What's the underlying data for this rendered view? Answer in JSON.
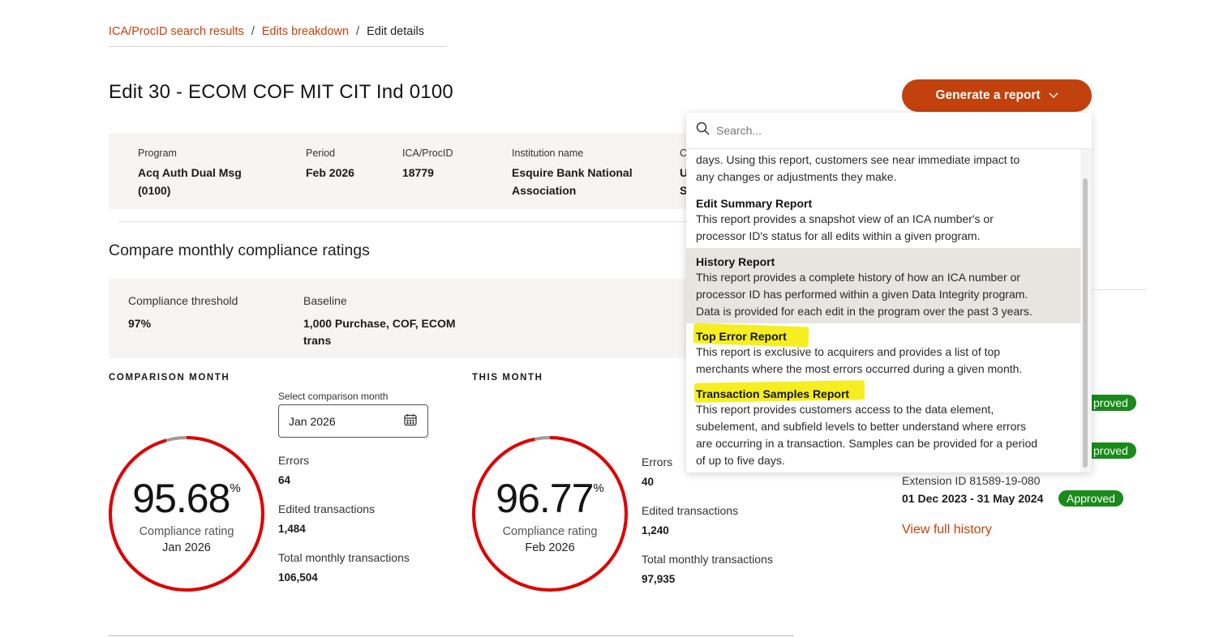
{
  "breadcrumb": {
    "items": [
      "ICA/ProcID search results",
      "Edits breakdown"
    ],
    "separator": "/",
    "current": "Edit details"
  },
  "page_title": "Edit 30 - ECOM COF MIT CIT Ind 0100",
  "generate_button": {
    "label": "Generate a report",
    "icon": "chevron-down-icon"
  },
  "info": {
    "program": {
      "label": "Program",
      "value_line1": "Acq Auth Dual Msg",
      "value_line2": "(0100)"
    },
    "period": {
      "label": "Period",
      "value": "Feb 2026"
    },
    "ica": {
      "label": "ICA/ProcID",
      "value": "18779"
    },
    "institution": {
      "label": "Institution name",
      "value_line1": "Esquire Bank National",
      "value_line2": "Association"
    },
    "partial": {
      "label": "C",
      "value_line1": "U",
      "value_line2": "S"
    }
  },
  "compare_section": {
    "title": "Compare monthly compliance ratings",
    "threshold_label": "Compliance threshold",
    "threshold_value": "97%",
    "baseline_label": "Baseline",
    "baseline_value_line1": "1,000 Purchase, COF, ECOM",
    "baseline_value_line2": "trans"
  },
  "comparison_month": {
    "heading": "COMPARISON MONTH",
    "select_label": "Select comparison month",
    "select_value": "Jan 2026",
    "rating": "95.68",
    "rating_unit": "%",
    "rating_fraction": 0.9568,
    "rating_caption": "Compliance rating",
    "rating_month": "Jan 2026",
    "errors_label": "Errors",
    "errors_value": "64",
    "edited_label": "Edited transactions",
    "edited_value": "1,484",
    "total_label": "Total monthly transactions",
    "total_value": "106,504"
  },
  "this_month": {
    "heading": "THIS MONTH",
    "rating": "96.77",
    "rating_unit": "%",
    "rating_fraction": 0.9677,
    "rating_caption": "Compliance rating",
    "rating_month": "Feb 2026",
    "errors_label": "Errors",
    "errors_value": "40",
    "edited_label": "Edited transactions",
    "edited_value": "1,240",
    "total_label": "Total monthly transactions",
    "total_value": "97,935"
  },
  "extension": {
    "badge_partial_1": "proved",
    "badge_partial_2": "proved",
    "id_text": "Extension ID 81589-19-080",
    "date_range": "01 Dec 2023 - 31 May 2024",
    "status": "Approved",
    "view_history": "View full history"
  },
  "dropdown": {
    "search_placeholder": "Search...",
    "search_icon": "search-icon",
    "partial_desc_line1": "days. Using this report, customers see near immediate impact to",
    "partial_desc_line2": "any changes or adjustments they make.",
    "items": [
      {
        "title": "Edit Summary Report",
        "desc_line1": "This report provides a snapshot view of an ICA number's or",
        "desc_line2": "processor ID's status for all edits within a given program."
      },
      {
        "title": "History Report",
        "desc_line1": "This report provides a complete history of how an ICA number or",
        "desc_line2": "processor ID has performed within a given Data Integrity program.",
        "desc_line3": "Data is provided for each edit in the program over the past 3 years."
      },
      {
        "title": "Top Error Report",
        "desc_line1": "This report is exclusive to acquirers and provides a list of top",
        "desc_line2": "merchants where the most errors occurred during a given month."
      },
      {
        "title": "Transaction Samples Report",
        "desc_line1": "This report provides customers access to the data element,",
        "desc_line2": "subelement, and subfield levels to better understand where errors",
        "desc_line3": "are occurring in a transaction. Samples can be provided for a period",
        "desc_line4": "of up to five days."
      }
    ]
  },
  "colors": {
    "accent": "#c2410c",
    "ring_red": "#e00000",
    "ring_gap": "#a89890",
    "approved_green": "#1a8a1a",
    "highlight_marker": "#f6ee21"
  }
}
